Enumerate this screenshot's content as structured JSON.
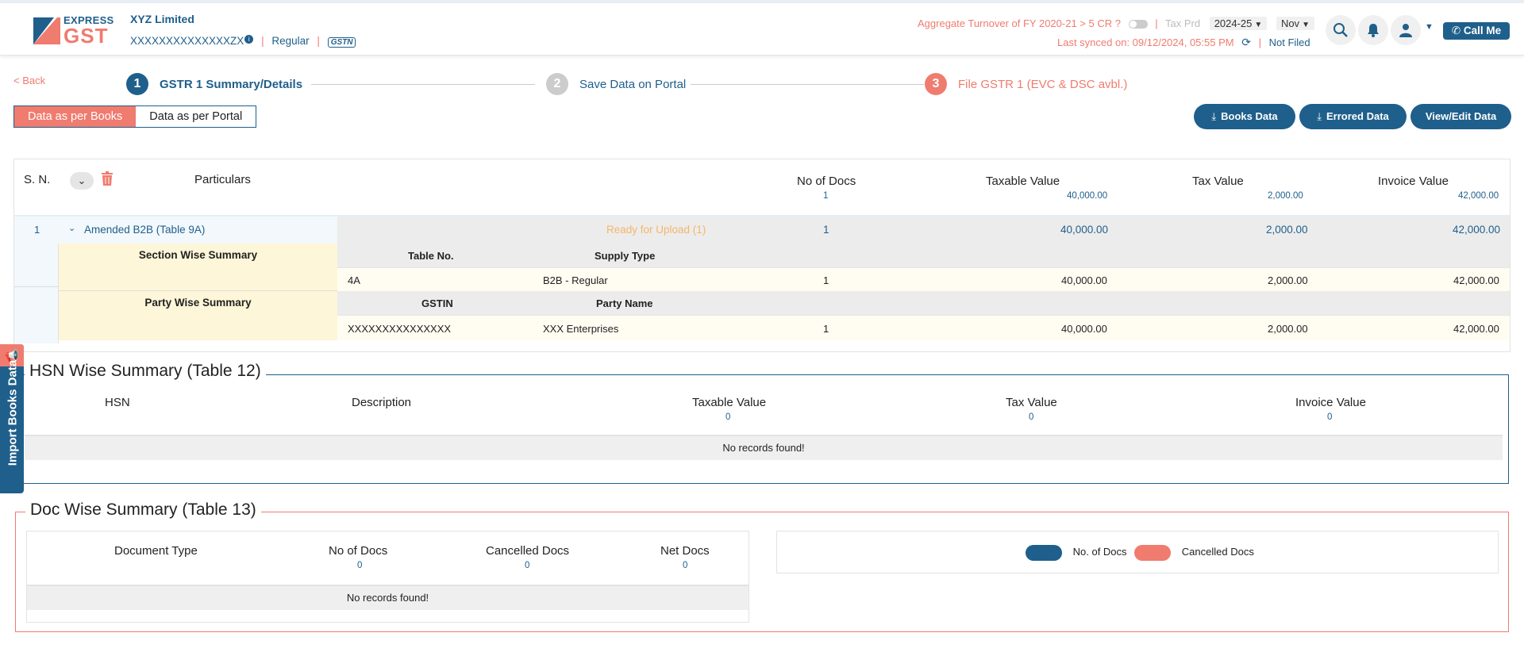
{
  "brand": {
    "line1": "EXPRESS",
    "line2": "GST"
  },
  "company": {
    "name": "XYZ Limited",
    "gstin": "XXXXXXXXXXXXXXZX",
    "type": "Regular",
    "gstn_label": "GSTN"
  },
  "header": {
    "aggregate_label": "Aggregate Turnover of FY 2020-21 > 5 CR ?",
    "tax_period_label": "Tax Prd",
    "year": "2024-25",
    "month": "Nov",
    "last_synced": "Last synced on: 09/12/2024, 05:55 PM",
    "filing_status": "Not Filed",
    "call_me": "Call Me"
  },
  "nav": {
    "back": "< Back"
  },
  "steps": [
    {
      "num": "1",
      "label": "GSTR 1 Summary/Details",
      "color": "#1f5f8b"
    },
    {
      "num": "2",
      "label": "Save Data on Portal",
      "color": "#1f5f8b"
    },
    {
      "num": "3",
      "label": "File GSTR 1 (EVC & DSC avbl.)",
      "color": "#f07b6f"
    }
  ],
  "view_tabs": {
    "books": "Data as per Books",
    "portal": "Data as per Portal"
  },
  "actions": {
    "books_data": "Books Data",
    "errored_data": "Errored Data",
    "view_edit": "View/Edit Data"
  },
  "summary_table": {
    "headers": {
      "sn": "S. N.",
      "particulars": "Particulars",
      "no_of_docs": "No of Docs",
      "taxable_value": "Taxable Value",
      "tax_value": "Tax Value",
      "invoice_value": "Invoice Value"
    },
    "totals": {
      "no_of_docs": "1",
      "taxable_value": "40,000.00",
      "tax_value": "2,000.00",
      "invoice_value": "42,000.00"
    },
    "row": {
      "sn": "1",
      "label": "Amended B2B (Table 9A)",
      "status": "Ready for Upload (1)",
      "no_of_docs": "1",
      "taxable_value": "40,000.00",
      "tax_value": "2,000.00",
      "invoice_value": "42,000.00"
    },
    "section_wise": {
      "title": "Section Wise Summary",
      "col1": "Table No.",
      "col2": "Supply Type",
      "rows": [
        {
          "c1": "4A",
          "c2": "B2B - Regular",
          "docs": "1",
          "taxable": "40,000.00",
          "tax": "2,000.00",
          "invoice": "42,000.00"
        }
      ]
    },
    "party_wise": {
      "title": "Party Wise Summary",
      "col1": "GSTIN",
      "col2": "Party Name",
      "rows": [
        {
          "c1": "XXXXXXXXXXXXXXX",
          "c2": "XXX Enterprises",
          "docs": "1",
          "taxable": "40,000.00",
          "tax": "2,000.00",
          "invoice": "42,000.00"
        }
      ]
    }
  },
  "hsn": {
    "title": "HSN Wise Summary (Table 12)",
    "headers": {
      "hsn": "HSN",
      "description": "Description",
      "taxable_value": "Taxable Value",
      "tax_value": "Tax Value",
      "invoice_value": "Invoice Value"
    },
    "totals": {
      "taxable_value": "0",
      "tax_value": "0",
      "invoice_value": "0"
    },
    "empty": "No records found!"
  },
  "doc": {
    "title": "Doc Wise Summary (Table 13)",
    "headers": {
      "document_type": "Document Type",
      "no_of_docs": "No of Docs",
      "cancelled_docs": "Cancelled Docs",
      "net_docs": "Net Docs"
    },
    "totals": {
      "no_of_docs": "0",
      "cancelled_docs": "0",
      "net_docs": "0"
    },
    "empty": "No records found!",
    "legend": [
      {
        "label": "No. of Docs",
        "color": "#1f5f8b"
      },
      {
        "label": "Cancelled Docs",
        "color": "#f07b6f"
      }
    ]
  },
  "side_tab": {
    "label": "Import Books Data"
  },
  "colors": {
    "primary": "#1f5f8b",
    "accent": "#f07b6f",
    "status": "#f5b66b",
    "highlight": "#fdf6d8"
  }
}
